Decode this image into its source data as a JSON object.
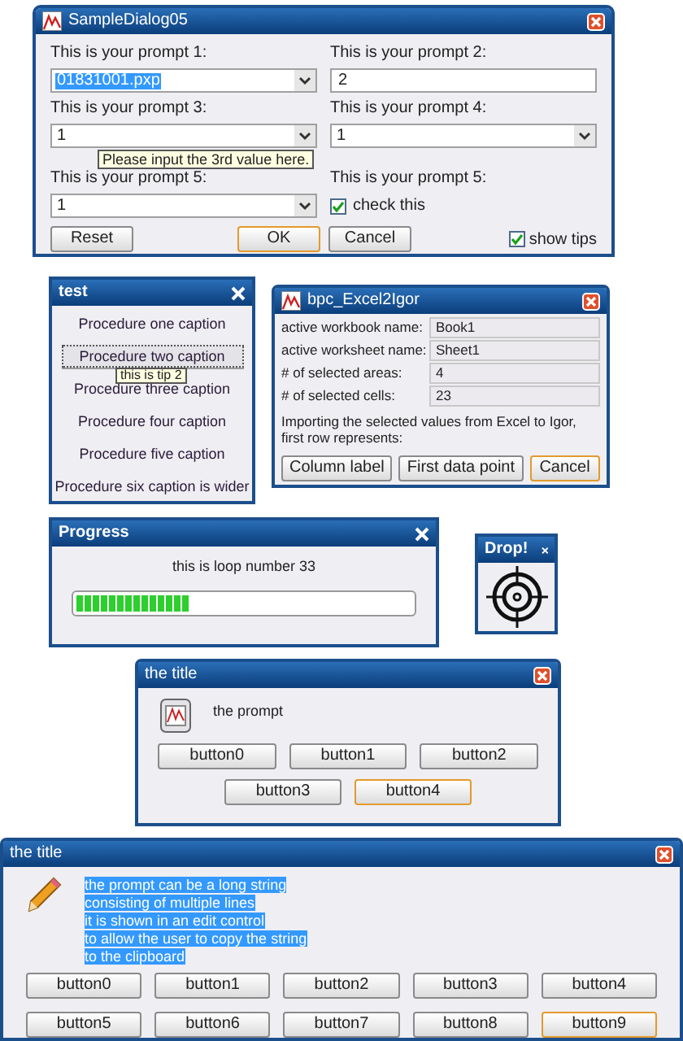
{
  "dialog_1": {
    "title": "SampleDialog05",
    "close_button": {
      "kind": "red"
    },
    "fields": [
      {
        "kind": "combo",
        "label": "This is your prompt 1:",
        "value": "01831001.pxp",
        "selected": true
      },
      {
        "kind": "text",
        "label": "This is your prompt 2:",
        "value": "2",
        "selected": false
      },
      {
        "kind": "combo",
        "label": "This is your prompt 3:",
        "value": "1",
        "selected": false
      },
      {
        "kind": "combo",
        "label": "This is your prompt 4:",
        "value": "1",
        "selected": false
      },
      {
        "kind": "combo",
        "label": "This is your prompt 5:",
        "value": "1",
        "selected": false
      },
      {
        "kind": "checkbox",
        "label": "This is your prompt 5:",
        "value": "check this",
        "checked": true
      }
    ],
    "tooltip": "Please input the 3rd value here.",
    "buttons": [
      {
        "label": "Reset",
        "default": false
      },
      {
        "label": "OK",
        "default": true
      },
      {
        "label": "Cancel",
        "default": false
      }
    ],
    "show_tips": {
      "label": "show tips",
      "checked": true
    }
  },
  "test_panel": {
    "title": "test",
    "close_button": {
      "kind": "plain"
    },
    "items": [
      {
        "label": "Procedure one caption",
        "focused": false
      },
      {
        "label": "Procedure two caption",
        "focused": true
      },
      {
        "label": "Procedure three caption",
        "focused": false
      },
      {
        "label": "Procedure four caption",
        "focused": false
      },
      {
        "label": "Procedure five caption",
        "focused": false
      },
      {
        "label": "Procedure six caption is wider",
        "focused": false
      }
    ],
    "tooltip": "this is tip 2"
  },
  "excel_dialog": {
    "title": "bpc_Excel2Igor",
    "close_button": {
      "kind": "red"
    },
    "rows": [
      {
        "label": "active workbook name:",
        "value": "Book1"
      },
      {
        "label": "active worksheet name:",
        "value": "Sheet1"
      },
      {
        "label": "# of selected areas:",
        "value": "4"
      },
      {
        "label": "# of selected cells:",
        "value": "23"
      }
    ],
    "message": "Importing the selected values from Excel to Igor, first row represents:",
    "buttons": [
      {
        "label": "Column label",
        "default": false
      },
      {
        "label": "First data point",
        "default": false
      },
      {
        "label": "Cancel",
        "default": true
      }
    ]
  },
  "progress": {
    "title": "Progress",
    "close_button": {
      "kind": "plain"
    },
    "message": "this is loop number 33",
    "level": 0.34
  },
  "drop": {
    "title": "Drop!",
    "close_button": {
      "kind": "plain"
    }
  },
  "small_dialog": {
    "title": "the title",
    "close_button": {
      "kind": "red"
    },
    "prompt": "the prompt",
    "buttons": [
      {
        "label": "button0",
        "default": false
      },
      {
        "label": "button1",
        "default": false
      },
      {
        "label": "button2",
        "default": false
      },
      {
        "label": "button3",
        "default": false
      },
      {
        "label": "button4",
        "default": true
      }
    ]
  },
  "large_dialog": {
    "title": "the title",
    "close_button": {
      "kind": "red"
    },
    "prompt": {
      "text": "the prompt can be a long string\nconsisting of multiple lines\nit is shown in an edit control\nto allow the user to copy the string\nto the clipboard",
      "selected": true
    },
    "buttons": [
      {
        "label": "button0",
        "default": false
      },
      {
        "label": "button1",
        "default": false
      },
      {
        "label": "button2",
        "default": false
      },
      {
        "label": "button3",
        "default": false
      },
      {
        "label": "button4",
        "default": false
      },
      {
        "label": "button5",
        "default": false
      },
      {
        "label": "button6",
        "default": false
      },
      {
        "label": "button7",
        "default": false
      },
      {
        "label": "button8",
        "default": false
      },
      {
        "label": "button9",
        "default": true
      }
    ]
  }
}
